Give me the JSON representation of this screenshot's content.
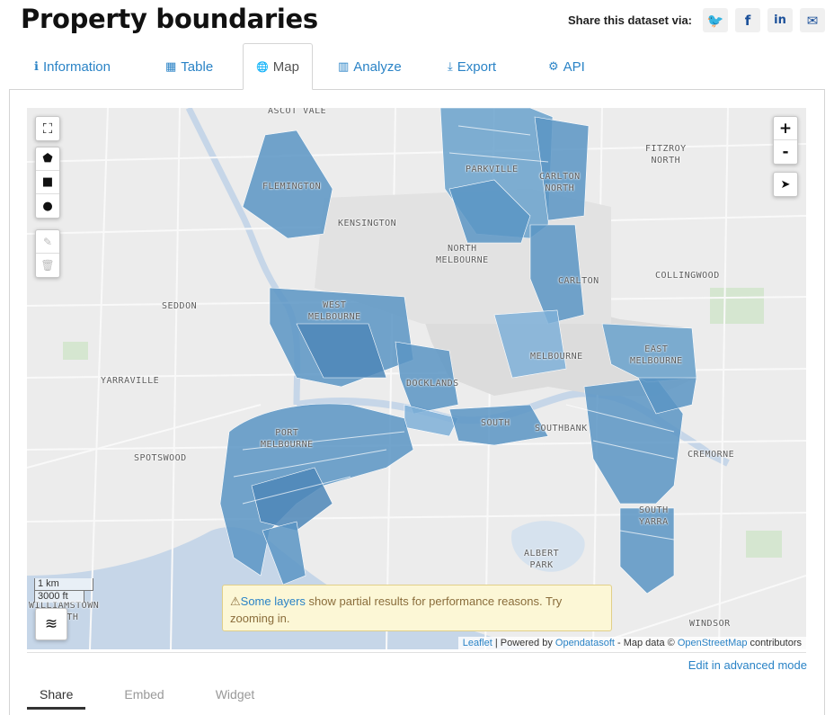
{
  "header": {
    "title": "Property boundaries",
    "share_label": "Share this dataset via:",
    "share_buttons": [
      {
        "icon": "twitter-icon",
        "glyph": "🐦"
      },
      {
        "icon": "facebook-icon",
        "glyph": "f"
      },
      {
        "icon": "linkedin-icon",
        "glyph": "in"
      },
      {
        "icon": "email-icon",
        "glyph": "✉"
      }
    ]
  },
  "tabs": [
    {
      "label": "Information",
      "icon": "info-icon",
      "glyph": "ℹ"
    },
    {
      "label": "Table",
      "icon": "table-icon",
      "glyph": "▦"
    },
    {
      "label": "Map",
      "icon": "globe-icon",
      "glyph": "🌐"
    },
    {
      "label": "Analyze",
      "icon": "bar-chart-icon",
      "glyph": "▥"
    },
    {
      "label": "Export",
      "icon": "download-icon",
      "glyph": "⤓"
    },
    {
      "label": "API",
      "icon": "cogs-icon",
      "glyph": "⚙"
    }
  ],
  "active_tab": "Map",
  "map": {
    "labels": {
      "ascot_vale": "ASCOT VALE",
      "flemington": "FLEMINGTON",
      "kensington": "KENSINGTON",
      "parkville": "PARKVILLE",
      "carlton_north": "CARLTON\nNORTH",
      "fitzroy_north": "FITZROY\nNORTH",
      "north_melbourne": "NORTH\nMELBOURNE",
      "carlton": "CARLTON",
      "collingwood": "COLLINGWOOD",
      "seddon": "SEDDON",
      "west_melbourne": "WEST\nMELBOURNE",
      "melbourne": "MELBOURNE",
      "east_melbourne": "EAST\nMELBOURNE",
      "yarraville": "YARRAVILLE",
      "docklands": "DOCKLANDS",
      "southbank": "SOUTHBANK",
      "south_wharf": "SOUTH",
      "cremorne": "CREMORNE",
      "spotswood": "SPOTSWOOD",
      "port_melbourne": "PORT\nMELBOURNE",
      "south_yarra": "SOUTH\nYARRA",
      "albert_park": "ALBERT\nPARK",
      "williamstown": "WILLIAMSTOWN\nNORTH",
      "windsor": "WINDSOR"
    },
    "zoom_in": "+",
    "zoom_out": "-",
    "scale_km": "1 km",
    "scale_ft": "3000 ft",
    "warning_link": "Some layers",
    "warning_text": " show partial results for performance reasons. Try zooming in.",
    "attribution": {
      "leaflet": "Leaflet",
      "powered": " | Powered by ",
      "ods": "Opendatasoft",
      "mapdata": " - Map data © ",
      "osm": "OpenStreetMap",
      "contrib": " contributors"
    },
    "colors": {
      "parcel": "#5b95c4",
      "parcel_light": "#8bb4d8",
      "water": "#c6d6e8",
      "land": "#ececec",
      "park": "#d5e6d0"
    }
  },
  "edit_advanced": "Edit in advanced mode",
  "subtabs": [
    "Share",
    "Embed",
    "Widget"
  ]
}
